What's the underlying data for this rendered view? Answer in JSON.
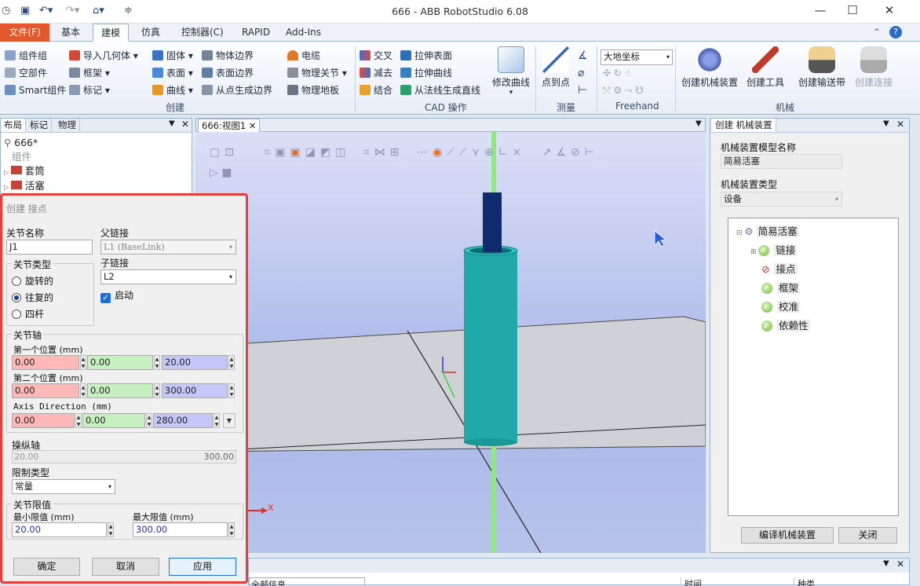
{
  "window": {
    "title": "666 - ABB RobotStudio 6.08"
  },
  "menu_tabs": [
    "文件(F)",
    "基本",
    "建模",
    "仿真",
    "控制器(C)",
    "RAPID",
    "Add-Ins"
  ],
  "active_tab": "建模",
  "ribbon": {
    "create": {
      "label": "创建",
      "items": [
        "组件组",
        "空部件",
        "Smart组件",
        "导入几何体",
        "框架",
        "标记",
        "固体",
        "表面",
        "曲线",
        "物体边界",
        "表面边界",
        "从点生成边界",
        "电缆",
        "物理关节",
        "物理地板"
      ]
    },
    "cad": {
      "label": "CAD 操作",
      "items": [
        "交叉",
        "减去",
        "结合",
        "拉伸表面",
        "拉伸曲线",
        "从法线生成直线"
      ],
      "big": "修改曲线"
    },
    "measure": {
      "label": "测量",
      "big": "点到点"
    },
    "freehand": {
      "label": "Freehand",
      "coord": "大地坐标"
    },
    "mechanism": {
      "label": "机械",
      "items": [
        "创建机械装置",
        "创建工具",
        "创建输送带",
        "创建连接"
      ]
    }
  },
  "left_panel": {
    "tabs": [
      "布局",
      "标记",
      "物理"
    ],
    "root": "666*",
    "group": "组件",
    "items": [
      "套筒",
      "活塞"
    ]
  },
  "viewport": {
    "tab": "666:视图1",
    "axis_x": "X"
  },
  "dialog": {
    "title": "创建 接点",
    "joint_name_label": "关节名称",
    "joint_name": "J1",
    "parent_label": "父链接",
    "parent": "L1 (BaseLink)",
    "child_label": "子链接",
    "child": "L2",
    "enabled_label": "启动",
    "joint_type_label": "关节类型",
    "types": [
      "旋转的",
      "往复的",
      "四杆"
    ],
    "selected_type": "往复的",
    "axis_label": "关节轴",
    "first_pos_label": "第一个位置 (mm)",
    "first_pos": [
      "0.00",
      "0.00",
      "20.00"
    ],
    "second_pos_label": "第二个位置 (mm)",
    "second_pos": [
      "0.00",
      "0.00",
      "300.00"
    ],
    "axis_dir_label": "Axis Direction (mm)",
    "axis_dir": [
      "0.00",
      "0.00",
      "280.00"
    ],
    "jog_label": "操纵轴",
    "jog_min": "20.00",
    "jog_max": "300.00",
    "limit_type_label": "限制类型",
    "limit_type": "常量",
    "limits_label": "关节限值",
    "min_label": "最小限值 (mm)",
    "max_label": "最大限值 (mm)",
    "min": "20.00",
    "max": "300.00",
    "buttons": [
      "确定",
      "取消",
      "应用"
    ]
  },
  "right_panel": {
    "tab": "创建 机械装置",
    "model_name_label": "机械装置模型名称",
    "model_name": "简易活塞",
    "type_label": "机械装置类型",
    "type": "设备",
    "tree_root": "简易活塞",
    "tree_items": [
      "链接",
      "接点",
      "框架",
      "校准",
      "依赖性"
    ],
    "compile": "编译机械装置",
    "close": "关闭"
  },
  "bottom": {
    "filter": "全部信息",
    "time": "时间",
    "category": "种类"
  },
  "colors": {
    "file_tab": "#e2572b",
    "dialog_border": "#e2413e",
    "cylinder": "#1fa9a9",
    "rod": "#102a6e",
    "axis": "#7dde6e"
  }
}
